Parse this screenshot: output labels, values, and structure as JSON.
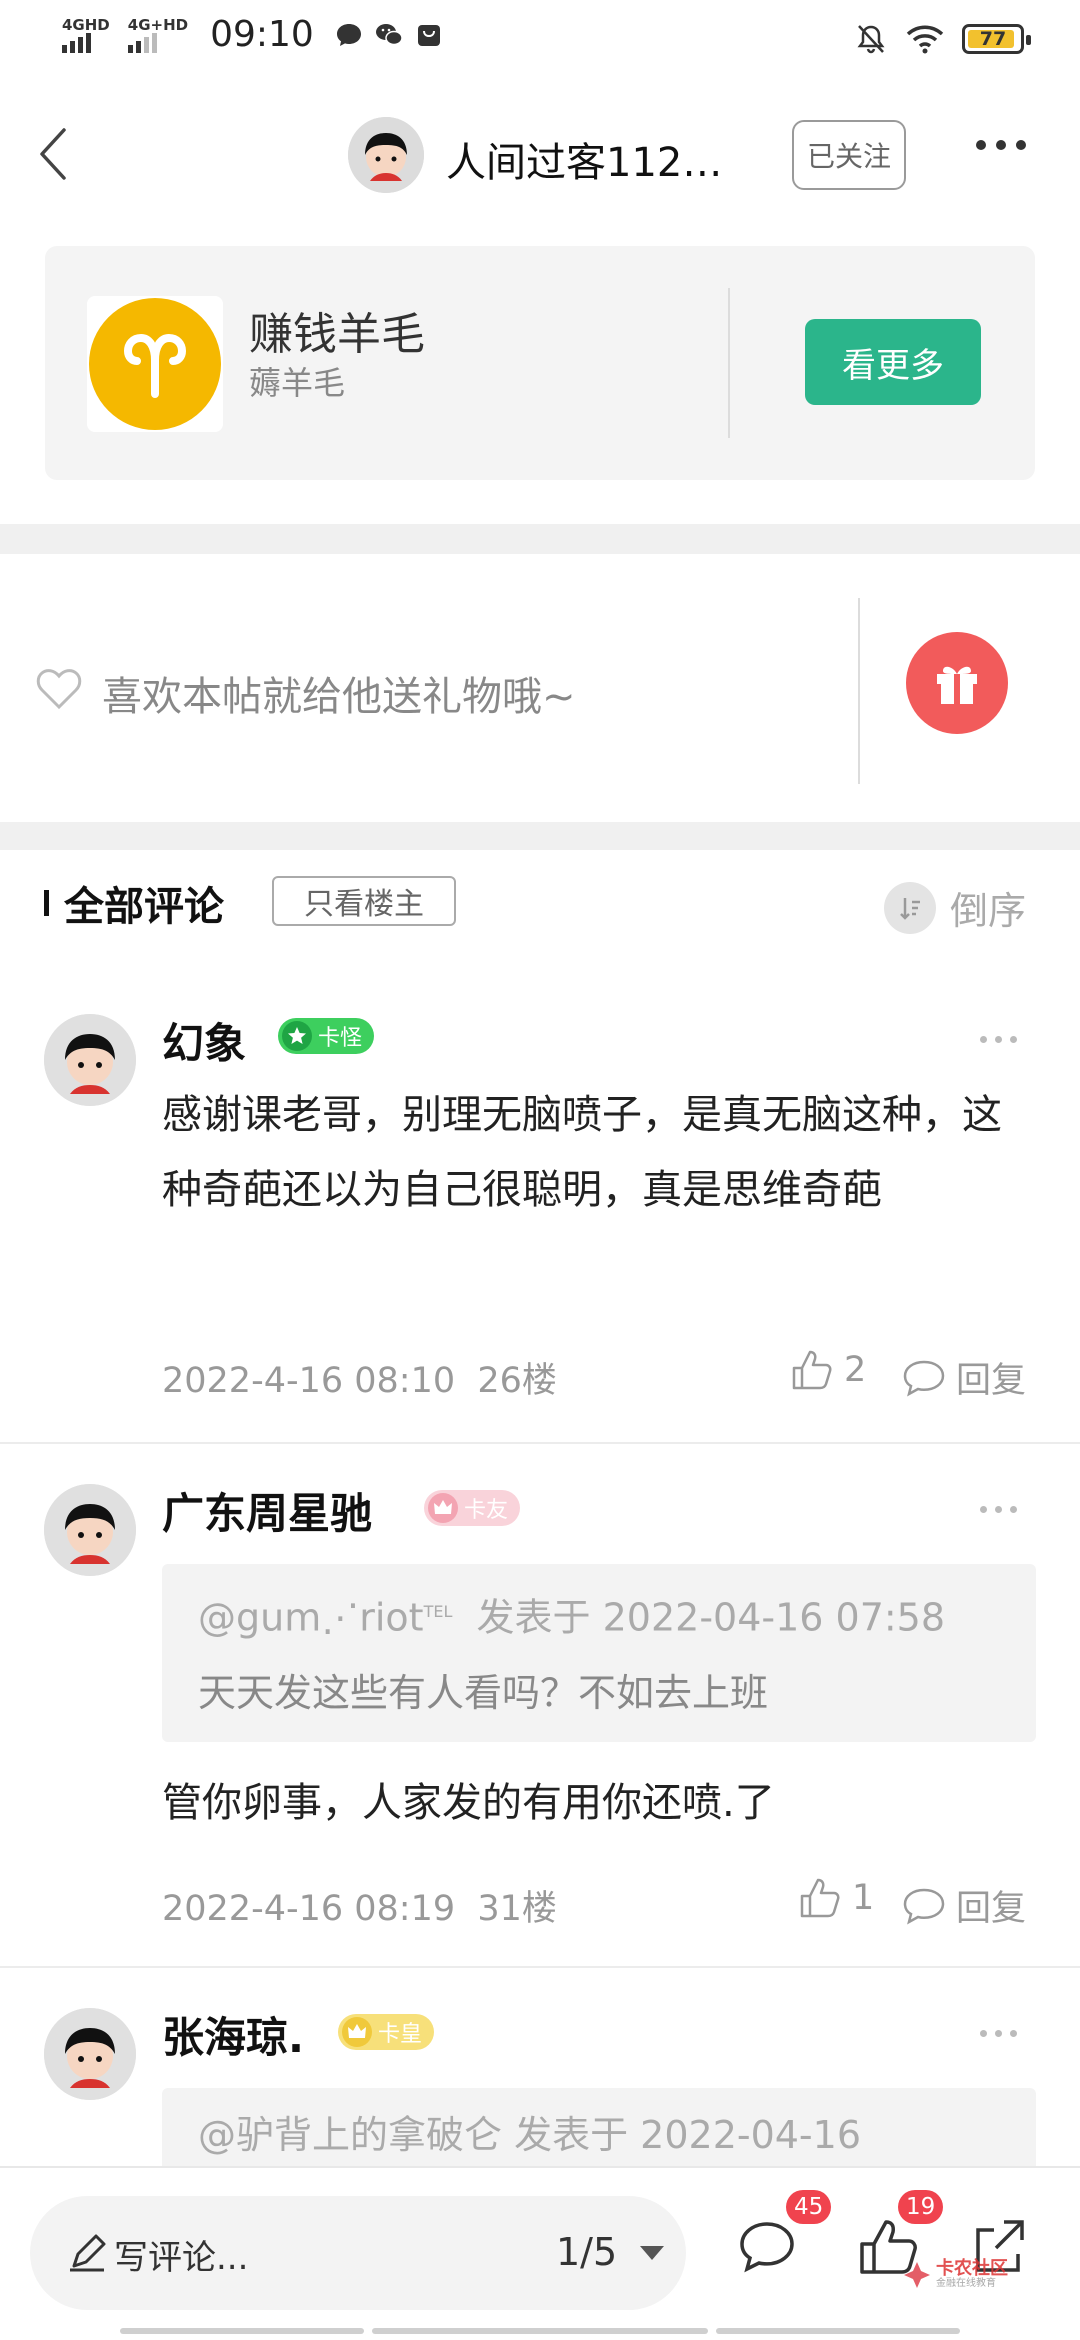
{
  "status_bar": {
    "net1": "4GHD",
    "net2": "4G+HD",
    "time": "09:10",
    "battery": "77"
  },
  "header": {
    "username": "人间过客112…",
    "follow_label": "已关注"
  },
  "circle": {
    "name": "赚钱羊毛",
    "subtitle": "薅羊毛",
    "see_more_label": "看更多",
    "logo_color": "#f5b800",
    "button_color": "#2bb58b"
  },
  "gift": {
    "prompt": "喜欢本帖就给他送礼物哦~",
    "button_color": "#f25b5b"
  },
  "comments_header": {
    "title": "全部评论",
    "filter_label": "只看楼主",
    "sort_label": "倒序"
  },
  "comments": [
    {
      "name": "幻象",
      "badge": "卡怪",
      "body": "感谢课老哥，别理无脑喷子，是真无脑这种，这种奇葩还以为自己很聪明，真是思维奇葩",
      "datetime": "2022-4-16 08:10",
      "floor": "26楼",
      "likes": "2",
      "reply_label": "回复"
    },
    {
      "name": "广东周星驰",
      "badge": "卡友",
      "quote_user": "@gum⋰riot",
      "quote_user_suffix": "TEL",
      "quote_meta": "发表于 2022-04-16 07:58",
      "quote_body": "天天发这些有人看吗？不如去上班",
      "body": "管你卵事，人家发的有用你还喷.了",
      "datetime": "2022-4-16 08:19",
      "floor": "31楼",
      "likes": "1",
      "reply_label": "回复"
    },
    {
      "name": "张海琼.",
      "badge": "卡皇",
      "quote_line": "@驴背上的拿破仑 发表于 2022-04-16"
    }
  ],
  "bottom_bar": {
    "write_label": "写评论...",
    "page_indicator": "1/5",
    "comment_count": "45",
    "like_count": "19",
    "watermark_title": "卡农社区",
    "watermark_sub": "金融在线教育"
  }
}
